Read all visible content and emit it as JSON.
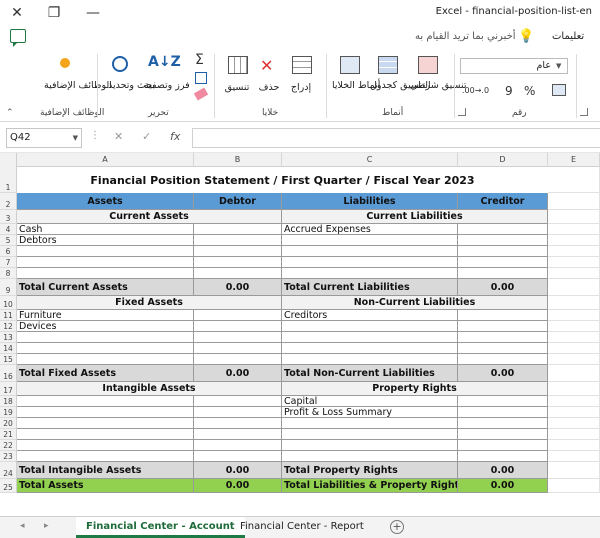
{
  "window": {
    "title": "Excel  -  financial-position-list-en",
    "close_glyph": "✕",
    "restore_glyph": "❐",
    "min_glyph": "—"
  },
  "toolbar": {
    "tell_me": "أخبرني بما تريد القيام به",
    "help_tab": "تعليمات"
  },
  "ribbon": {
    "number_format": "عام",
    "groups": {
      "addins": "الوظائف الإضافية",
      "editing": "تحرير",
      "cells": "خلايا",
      "styles": "أنماط",
      "number": "رقم"
    },
    "buttons": {
      "addins": "الوظائف الإضافية",
      "find": "بحث وتحديد",
      "sort": "فرز وتصفية",
      "format": "تنسيق",
      "delete": "حذف",
      "insert": "إدراج",
      "cell_styles": "أنماط الخلايا",
      "format_table": "التنسيق كجدول",
      "conditional": "تنسيق شرطي",
      "percent": "%",
      "comma": "9"
    }
  },
  "formula_bar": {
    "name_box": "Q42",
    "dots": "⋮",
    "cancel": "✕",
    "enter": "✓",
    "fx": "fx",
    "formula": ""
  },
  "columns": [
    "A",
    "B",
    "C",
    "D",
    "E"
  ],
  "rows": [
    "1",
    "2",
    "3",
    "4",
    "5",
    "6",
    "7",
    "8",
    "9",
    "10",
    "11",
    "12",
    "13",
    "14",
    "15",
    "16",
    "17",
    "18",
    "19",
    "20",
    "21",
    "22",
    "23",
    "24",
    "25"
  ],
  "sheet": {
    "title": "Financial Position Statement / First Quarter / Fiscal Year 2023",
    "headers": {
      "assets": "Assets",
      "debtor": "Debtor",
      "liabilities": "Liabilities",
      "creditor": "Creditor"
    },
    "current_assets": "Current Assets",
    "current_liabilities": "Current Liabilities",
    "cash": "Cash",
    "debtors": "Debtors",
    "accrued": "Accrued Expenses",
    "total_current_assets": "Total Current Assets",
    "total_current_liabilities": "Total Current Liabilities",
    "fixed_assets": "Fixed Assets",
    "non_current_liabilities": "Non-Current Liabilities",
    "furniture": "Furniture",
    "devices": "Devices",
    "creditors": "Creditors",
    "total_fixed_assets": "Total Fixed Assets",
    "total_non_current_liabilities": "Total Non-Current Liabilities",
    "intangible_assets": "Intangible Assets",
    "property_rights": "Property Rights",
    "capital": "Capital",
    "pl_summary": "Profit & Loss Summary",
    "total_intangible_assets": "Total Intangible Assets",
    "total_property_rights": "Total Property Rights",
    "total_assets": "Total Assets",
    "total_liabilities_property": "Total Liabilities & Property Rights",
    "zero": "0.00"
  },
  "tabs": {
    "account": "Financial Center - Account",
    "report": "Financial Center - Report",
    "add": "+",
    "prev": "◂",
    "next": "▸"
  }
}
